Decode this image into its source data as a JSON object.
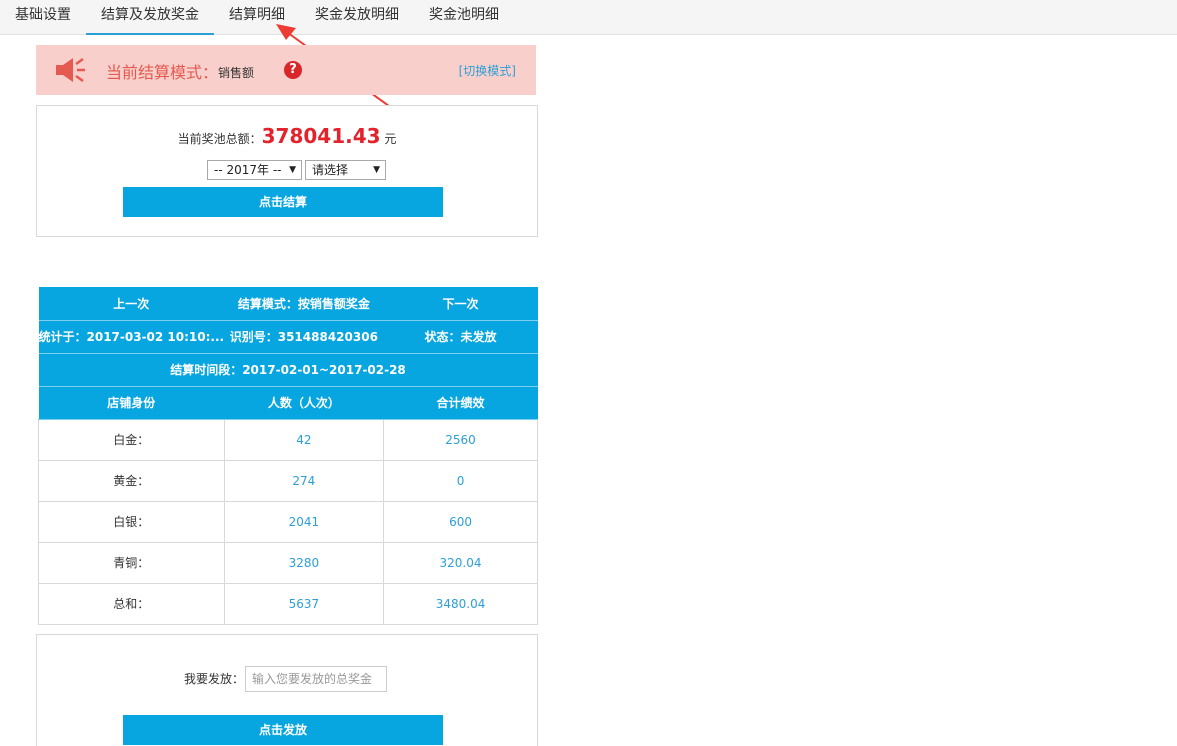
{
  "tabs": [
    {
      "label": "基础设置",
      "active": false
    },
    {
      "label": "结算及发放奖金",
      "active": true
    },
    {
      "label": "结算明细",
      "active": false
    },
    {
      "label": "奖金发放明细",
      "active": false
    },
    {
      "label": "奖金池明细",
      "active": false
    }
  ],
  "mode_banner": {
    "label": "当前结算模式：",
    "value": "销售额",
    "help_icon": "?",
    "switch_link": "[切换模式]",
    "background_color": "#f9cfcb",
    "icon": "speaker-icon"
  },
  "pool": {
    "label": "当前奖池总额：",
    "amount": "378041.43",
    "unit": "元",
    "year_select": "-- 2017年 --",
    "choose_select": "请选择",
    "settle_button": "点击结算"
  },
  "settlement": {
    "prev": "上一次",
    "mode": "结算模式：按销售额奖金",
    "next": "下一次",
    "stat_time": "统计于：2017-03-02 10:10:...",
    "id": "识别号：351488420306",
    "status": "状态：未发放",
    "period": "结算时间段：2017-02-01~2017-02-28",
    "headers": [
      "店铺身份",
      "人数（人次）",
      "合计绩效"
    ],
    "rows": [
      {
        "name": "白金：",
        "count": "42",
        "total": "2560"
      },
      {
        "name": "黄金：",
        "count": "274",
        "total": "0"
      },
      {
        "name": "白银：",
        "count": "2041",
        "total": "600"
      },
      {
        "name": "青铜：",
        "count": "3280",
        "total": "320.04"
      },
      {
        "name": "总和：",
        "count": "5637",
        "total": "3480.04"
      }
    ]
  },
  "distribute": {
    "label": "我要发放：",
    "placeholder": "输入您要发放的总奖金",
    "button": "点击发放"
  },
  "colors": {
    "accent_blue": "#08a6e0",
    "amount_red": "#e3222c",
    "link_blue": "#2d9fd8"
  }
}
